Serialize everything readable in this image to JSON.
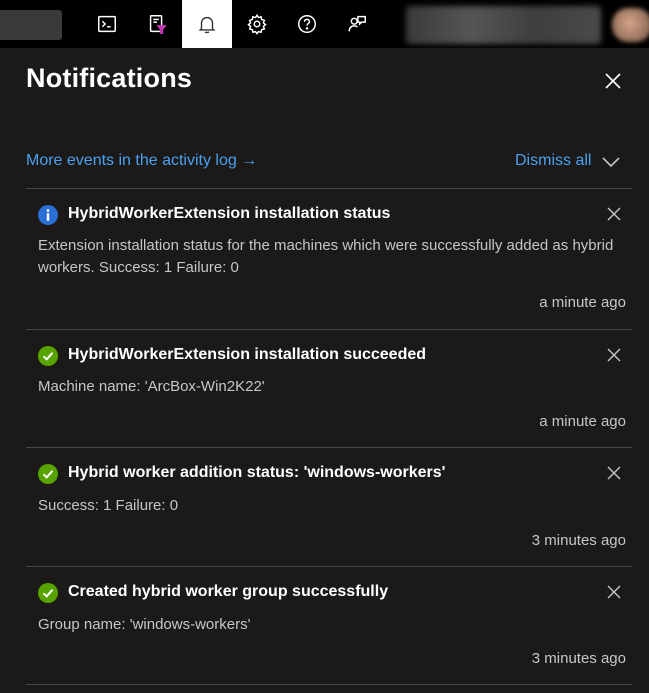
{
  "topbar": {
    "buttons": [
      {
        "name": "cloud-shell",
        "icon": "terminal-icon"
      },
      {
        "name": "directory-filter",
        "icon": "directory-filter-icon"
      },
      {
        "name": "notifications",
        "icon": "bell-icon",
        "active": true
      },
      {
        "name": "settings",
        "icon": "gear-icon"
      },
      {
        "name": "help",
        "icon": "help-icon"
      },
      {
        "name": "feedback",
        "icon": "feedback-icon"
      }
    ]
  },
  "panel": {
    "title": "Notifications",
    "activity_link": "More events in the activity log →",
    "dismiss_all": "Dismiss all"
  },
  "colors": {
    "link": "#4aa0f0",
    "info": "#2b6fd6",
    "success": "#57a300",
    "background": "#1b1a19"
  },
  "notifications": [
    {
      "status": "info",
      "title": "HybridWorkerExtension installation status",
      "body": "Extension installation status for the machines which were successfully added as hybrid workers. Success: 1 Failure: 0",
      "time": "a minute ago"
    },
    {
      "status": "success",
      "title": "HybridWorkerExtension installation succeeded",
      "body": "Machine name: 'ArcBox-Win2K22'",
      "time": "a minute ago"
    },
    {
      "status": "success",
      "title": "Hybrid worker addition status: 'windows-workers'",
      "body": "Success: 1 Failure: 0",
      "time": "3 minutes ago"
    },
    {
      "status": "success",
      "title": "Created hybrid worker group successfully",
      "body": "Group name: 'windows-workers'",
      "time": "3 minutes ago"
    }
  ]
}
